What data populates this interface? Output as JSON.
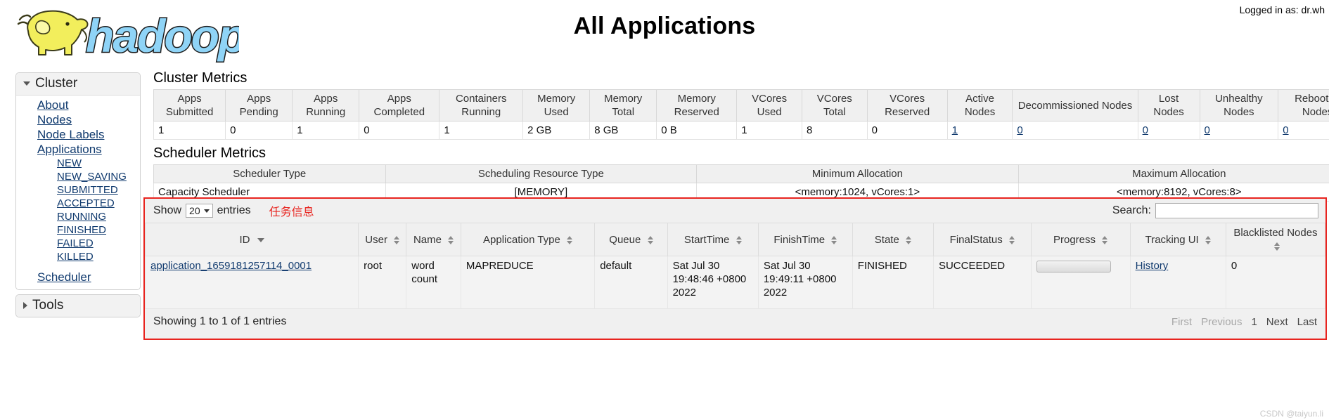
{
  "header": {
    "title": "All Applications",
    "logged_in": "Logged in as: dr.wh",
    "logo_alt": "hadoop-logo"
  },
  "sidebar": {
    "cluster": {
      "label": "Cluster",
      "caret": "caret-down-icon",
      "items": [
        {
          "label": "About",
          "level": "top"
        },
        {
          "label": "Nodes",
          "level": "top"
        },
        {
          "label": "Node Labels",
          "level": "top"
        },
        {
          "label": "Applications",
          "level": "top"
        },
        {
          "label": "NEW",
          "level": "sub"
        },
        {
          "label": "NEW_SAVING",
          "level": "sub"
        },
        {
          "label": "SUBMITTED",
          "level": "sub"
        },
        {
          "label": "ACCEPTED",
          "level": "sub"
        },
        {
          "label": "RUNNING",
          "level": "sub"
        },
        {
          "label": "FINISHED",
          "level": "sub"
        },
        {
          "label": "FAILED",
          "level": "sub"
        },
        {
          "label": "KILLED",
          "level": "sub"
        },
        {
          "label": "Scheduler",
          "level": "top"
        }
      ]
    },
    "tools": {
      "label": "Tools",
      "caret": "caret-right-icon"
    }
  },
  "cluster_metrics": {
    "title": "Cluster Metrics",
    "headers": [
      "Apps Submitted",
      "Apps Pending",
      "Apps Running",
      "Apps Completed",
      "Containers Running",
      "Memory Used",
      "Memory Total",
      "Memory Reserved",
      "VCores Used",
      "VCores Total",
      "VCores Reserved",
      "Active Nodes",
      "Decommissioned Nodes",
      "Lost Nodes",
      "Unhealthy Nodes",
      "Rebooted Nodes"
    ],
    "values": [
      "1",
      "0",
      "1",
      "0",
      "1",
      "2 GB",
      "8 GB",
      "0 B",
      "1",
      "8",
      "0",
      "1",
      "0",
      "0",
      "0",
      "0"
    ],
    "link_columns": [
      11,
      12,
      13,
      14,
      15
    ]
  },
  "scheduler_metrics": {
    "title": "Scheduler Metrics",
    "headers": [
      "Scheduler Type",
      "Scheduling Resource Type",
      "Minimum Allocation",
      "Maximum Allocation"
    ],
    "values": [
      "Capacity Scheduler",
      "[MEMORY]",
      "<memory:1024, vCores:1>",
      "<memory:8192, vCores:8>"
    ]
  },
  "apps_table": {
    "show_label": "Show",
    "entries_label": "entries",
    "page_size": "20",
    "annotation": "任务信息",
    "search_label": "Search:",
    "search_value": "",
    "search_placeholder": "",
    "headers": [
      "ID",
      "User",
      "Name",
      "Application Type",
      "Queue",
      "StartTime",
      "FinishTime",
      "State",
      "FinalStatus",
      "Progress",
      "Tracking UI",
      "Blacklisted Nodes"
    ],
    "rows": [
      {
        "id": "application_1659181257114_0001",
        "user": "root",
        "name": "word count",
        "application_type": "MAPREDUCE",
        "queue": "default",
        "start_time": "Sat Jul 30 19:48:46 +0800 2022",
        "finish_time": "Sat Jul 30 19:49:11 +0800 2022",
        "state": "FINISHED",
        "final_status": "SUCCEEDED",
        "progress": "100",
        "tracking_ui": "History",
        "blacklisted_nodes": "0"
      }
    ],
    "footer_info": "Showing 1 to 1 of 1 entries",
    "paging": {
      "first": "First",
      "previous": "Previous",
      "page": "1",
      "next": "Next",
      "last": "Last"
    }
  },
  "watermark": "CSDN @taiyun.li",
  "colors": {
    "annotation_red": "#e8241f",
    "link_blue": "#103a6e",
    "header_gray": "#f0f0f0"
  }
}
